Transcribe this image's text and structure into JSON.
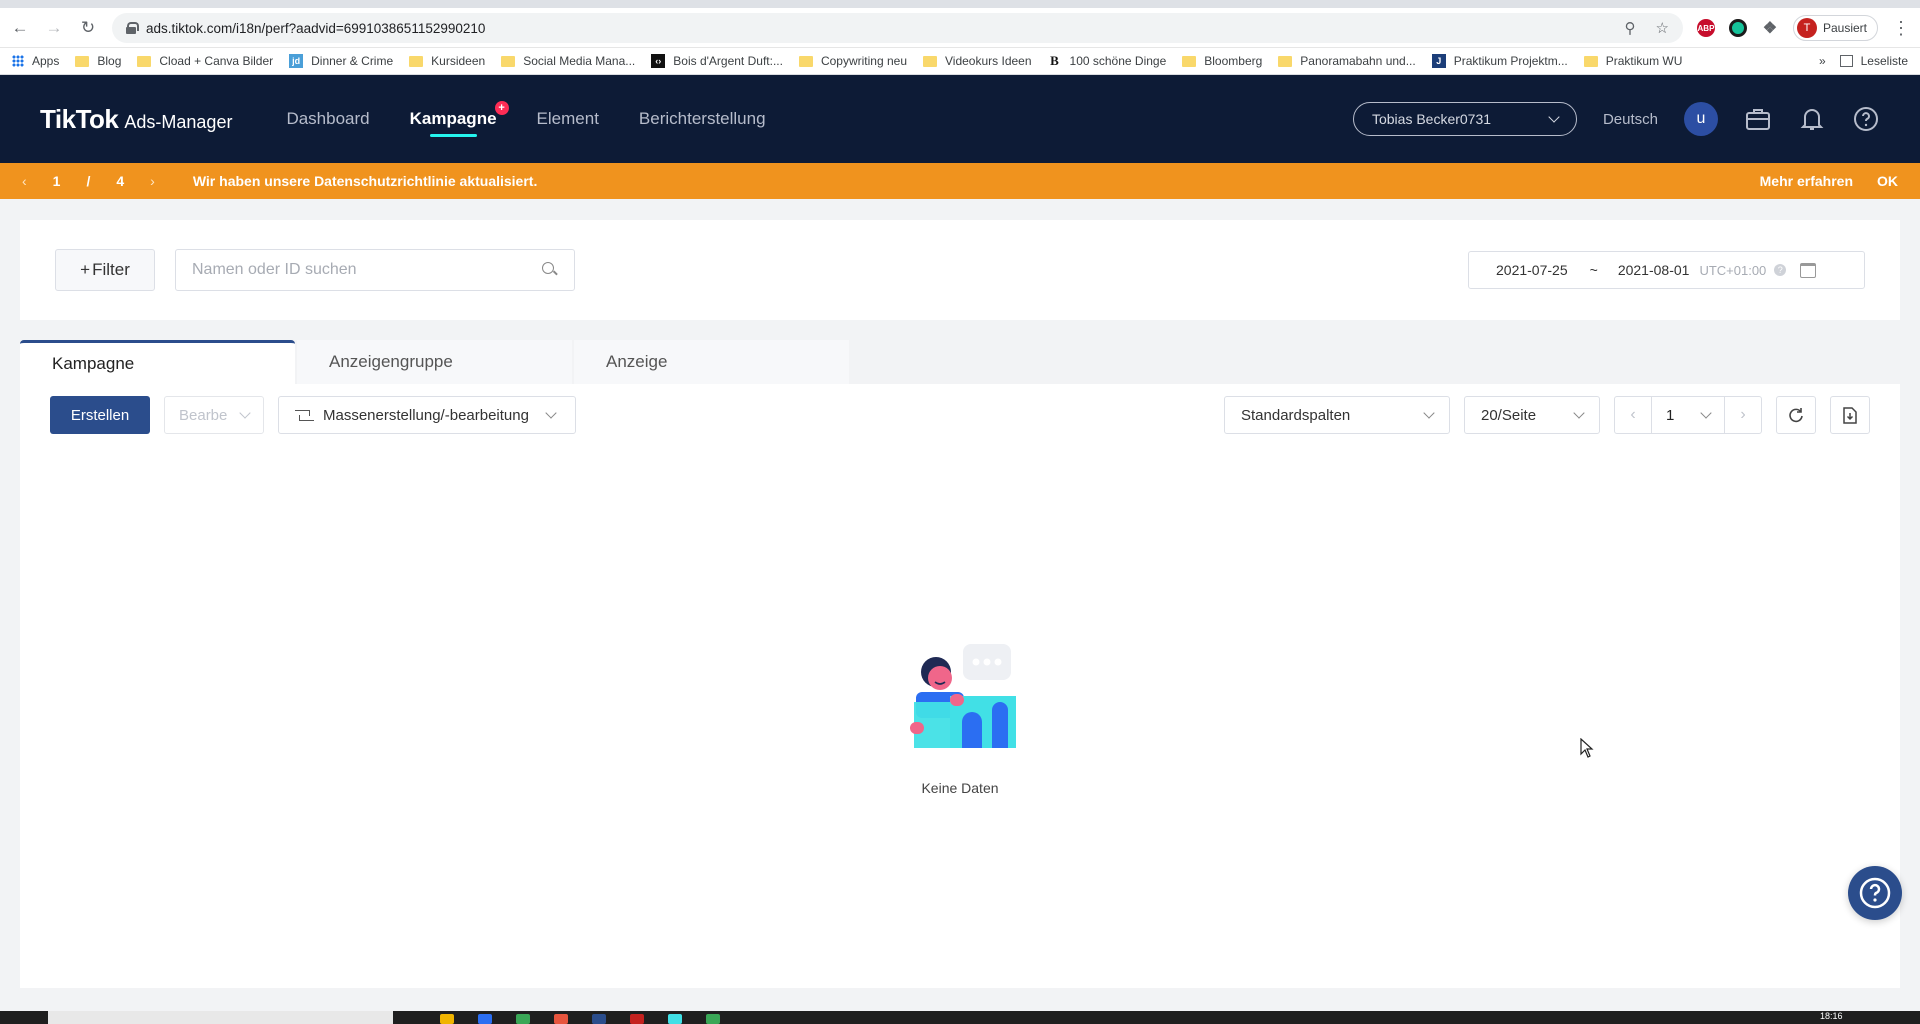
{
  "browser": {
    "url": "ads.tiktok.com/i18n/perf?aadvid=6991038651152990210",
    "profile_initial": "T",
    "profile_status": "Pausiert"
  },
  "bookmarks": {
    "apps": "Apps",
    "items": [
      {
        "label": "Blog",
        "icon": "folder"
      },
      {
        "label": "Cload + Canva Bilder",
        "icon": "folder"
      },
      {
        "label": "Dinner & Crime",
        "icon": "jd"
      },
      {
        "label": "Kursideen",
        "icon": "folder"
      },
      {
        "label": "Social Media Mana...",
        "icon": "folder"
      },
      {
        "label": "Bois d'Argent Duft:...",
        "icon": "boa"
      },
      {
        "label": "Copywriting neu",
        "icon": "folder"
      },
      {
        "label": "Videokurs Ideen",
        "icon": "folder"
      },
      {
        "label": "100 schöne Dinge",
        "icon": "b"
      },
      {
        "label": "Bloomberg",
        "icon": "folder"
      },
      {
        "label": "Panoramabahn und...",
        "icon": "folder"
      },
      {
        "label": "Praktikum Projektm...",
        "icon": "j"
      },
      {
        "label": "Praktikum WU",
        "icon": "folder"
      }
    ],
    "more": "»",
    "reading_list": "Leseliste"
  },
  "header": {
    "brand": "TikTok",
    "brand_sub": "Ads-Manager",
    "nav": {
      "dashboard": "Dashboard",
      "campaign": "Kampagne",
      "element": "Element",
      "reporting": "Berichterstellung"
    },
    "account": "Tobias Becker0731",
    "language": "Deutsch",
    "user_initial": "u"
  },
  "notice": {
    "page_current": "1",
    "page_sep": "/",
    "page_total": "4",
    "message": "Wir haben unsere Datenschutzrichtlinie aktualisiert.",
    "learn_more": "Mehr erfahren",
    "ok": "OK"
  },
  "filter": {
    "button": "Filter",
    "search_placeholder": "Namen oder ID suchen",
    "date_start": "2021-07-25",
    "date_sep": "~",
    "date_end": "2021-08-01",
    "timezone": "UTC+01:00"
  },
  "tabs": {
    "campaign": "Kampagne",
    "adgroup": "Anzeigengruppe",
    "ad": "Anzeige"
  },
  "toolbar": {
    "create": "Erstellen",
    "edit": "Bearbe",
    "bulk": "Massenerstellung/-bearbeitung",
    "columns": "Standardspalten",
    "page_size": "20/Seite",
    "page": "1"
  },
  "empty_state": {
    "label": "Keine Daten"
  },
  "taskbar": {
    "time": "18:16"
  },
  "colors": {
    "header_bg": "#0d1b36",
    "notice_bg": "#f0931e",
    "primary": "#2b4d8c",
    "accent_cyan": "#25f4ee",
    "accent_red": "#fe2c55"
  }
}
